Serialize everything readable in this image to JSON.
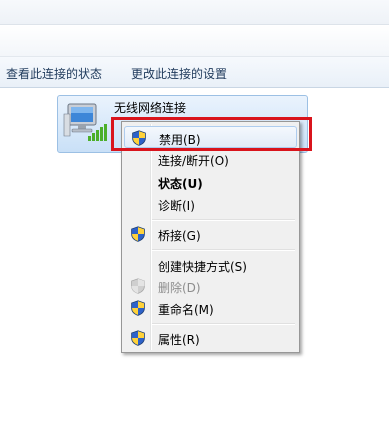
{
  "toolbar": {
    "view_status": "查看此连接的状态",
    "change_settings": "更改此连接的设置"
  },
  "connection": {
    "name": "无线网络连接",
    "icon": "wireless-network-adapter-icon"
  },
  "context_menu": {
    "items": [
      {
        "label": "禁用(B)",
        "icon": "uac-shield-icon",
        "highlighted": true
      },
      {
        "label": "连接/断开(O)"
      },
      {
        "label": "状态(U)",
        "bold": true
      },
      {
        "label": "诊断(I)"
      },
      {
        "label": "桥接(G)",
        "icon": "uac-shield-icon"
      },
      {
        "label": "创建快捷方式(S)"
      },
      {
        "label": "删除(D)",
        "icon": "uac-shield-icon",
        "disabled": true
      },
      {
        "label": "重命名(M)",
        "icon": "uac-shield-icon"
      },
      {
        "label": "属性(R)",
        "icon": "uac-shield-icon"
      }
    ]
  },
  "highlight_color": "#d9141c"
}
